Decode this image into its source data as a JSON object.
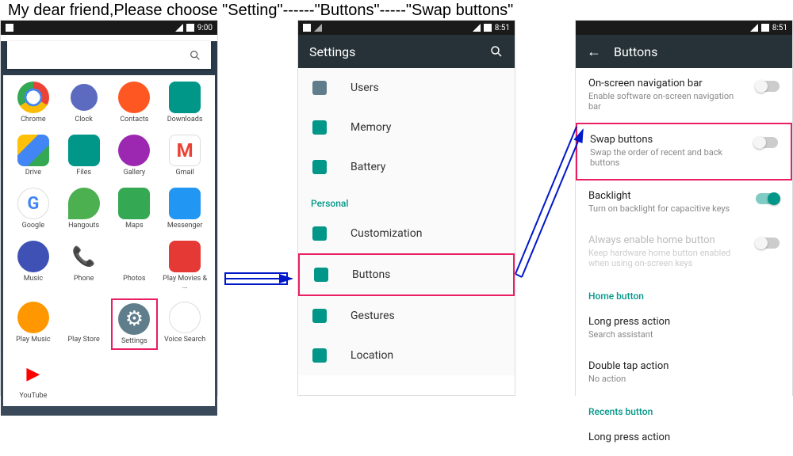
{
  "instruction": "My dear friend,Please choose \"Setting\"------\"Buttons\"-----\"Swap buttons\"",
  "time1": "9:00",
  "time2": "8:51",
  "time3": "8:51",
  "apps": [
    {
      "label": "Chrome",
      "cls": "ic-chrome"
    },
    {
      "label": "Clock",
      "cls": "ic-clock"
    },
    {
      "label": "Contacts",
      "cls": "ic-contacts"
    },
    {
      "label": "Downloads",
      "cls": "ic-downloads"
    },
    {
      "label": "Drive",
      "cls": "ic-drive"
    },
    {
      "label": "Files",
      "cls": "ic-files"
    },
    {
      "label": "Gallery",
      "cls": "ic-gallery"
    },
    {
      "label": "Gmail",
      "cls": "ic-gmail"
    },
    {
      "label": "Google",
      "cls": "ic-google"
    },
    {
      "label": "Hangouts",
      "cls": "ic-hangouts"
    },
    {
      "label": "Maps",
      "cls": "ic-maps"
    },
    {
      "label": "Messenger",
      "cls": "ic-messenger"
    },
    {
      "label": "Music",
      "cls": "ic-music"
    },
    {
      "label": "Phone",
      "cls": "ic-phone"
    },
    {
      "label": "Photos",
      "cls": "ic-photos"
    },
    {
      "label": "Play Movies & ...",
      "cls": "ic-playmovies"
    },
    {
      "label": "Play Music",
      "cls": "ic-playmusic"
    },
    {
      "label": "Play Store",
      "cls": "ic-playstore"
    },
    {
      "label": "Settings",
      "cls": "ic-settings",
      "highlight": true
    },
    {
      "label": "Voice Search",
      "cls": "ic-voice"
    },
    {
      "label": "YouTube",
      "cls": "ic-youtube"
    }
  ],
  "settings_header": "Settings",
  "settings_items": [
    {
      "label": "Users",
      "color": "#607d8b"
    },
    {
      "label": "Memory",
      "color": "#009688"
    },
    {
      "label": "Battery",
      "color": "#009688"
    }
  ],
  "personal_header": "Personal",
  "personal_items": [
    {
      "label": "Customization",
      "color": "#009688"
    },
    {
      "label": "Buttons",
      "color": "#009688",
      "highlight": true
    },
    {
      "label": "Gestures",
      "color": "#009688"
    },
    {
      "label": "Location",
      "color": "#009688"
    }
  ],
  "buttons_header": "Buttons",
  "buttons_items": [
    {
      "title": "On-screen navigation bar",
      "sub": "Enable software on-screen navigation bar",
      "on": false
    },
    {
      "title": "Swap buttons",
      "sub": "Swap the order of recent and back buttons",
      "on": false,
      "highlight": true
    },
    {
      "title": "Backlight",
      "sub": "Turn on backlight for capacitive keys",
      "on": true
    },
    {
      "title": "Always enable home button",
      "sub": "Keep hardware home button enabled when using on-screen keys",
      "on": false,
      "disabled": true
    }
  ],
  "home_button_header": "Home button",
  "home_items": [
    {
      "title": "Long press action",
      "sub": "Search assistant"
    },
    {
      "title": "Double tap action",
      "sub": "No action"
    }
  ],
  "recents_header": "Recents button",
  "recents_items": [
    {
      "title": "Long press action",
      "sub": ""
    }
  ]
}
